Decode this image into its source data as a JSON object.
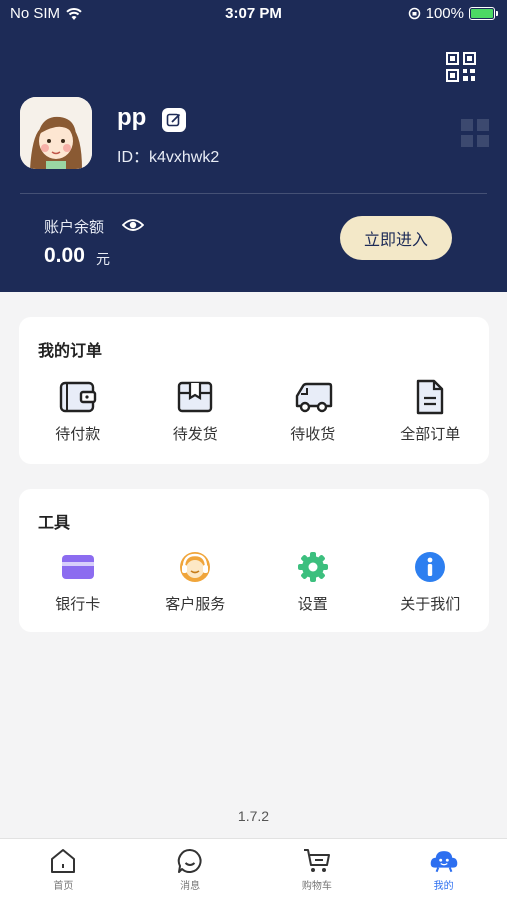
{
  "status_bar": {
    "carrier": "No SIM",
    "time": "3:07 PM",
    "battery": "100%"
  },
  "profile": {
    "username": "pp",
    "user_id": "ID：k4vxhwk2"
  },
  "balance": {
    "label": "账户余额",
    "value": "0.00",
    "unit": "元",
    "enter_label": "立即进入"
  },
  "orders": {
    "title": "我的订单",
    "items": [
      {
        "label": "待付款",
        "icon": "wallet-icon"
      },
      {
        "label": "待发货",
        "icon": "package-icon"
      },
      {
        "label": "待收货",
        "icon": "truck-icon"
      },
      {
        "label": "全部订单",
        "icon": "document-icon"
      }
    ]
  },
  "tools": {
    "title": "工具",
    "items": [
      {
        "label": "银行卡",
        "icon": "bank-card-icon"
      },
      {
        "label": "客户服务",
        "icon": "customer-service-icon"
      },
      {
        "label": "设置",
        "icon": "gear-icon"
      },
      {
        "label": "关于我们",
        "icon": "info-icon"
      }
    ]
  },
  "version": "1.7.2",
  "tabbar": {
    "items": [
      {
        "label": "首页",
        "icon": "home-icon"
      },
      {
        "label": "消息",
        "icon": "message-icon"
      },
      {
        "label": "购物车",
        "icon": "cart-icon"
      },
      {
        "label": "我的",
        "icon": "profile-icon",
        "active": true
      }
    ]
  },
  "colors": {
    "header_bg": "#1d2b57",
    "enter_button_bg": "#f3e8c8",
    "active_tab": "#2d6ff0",
    "card_purple": "#8c6cf0",
    "service_orange": "#f0a53a",
    "gear_green": "#3cbf7e",
    "info_blue": "#2d7ff0"
  }
}
